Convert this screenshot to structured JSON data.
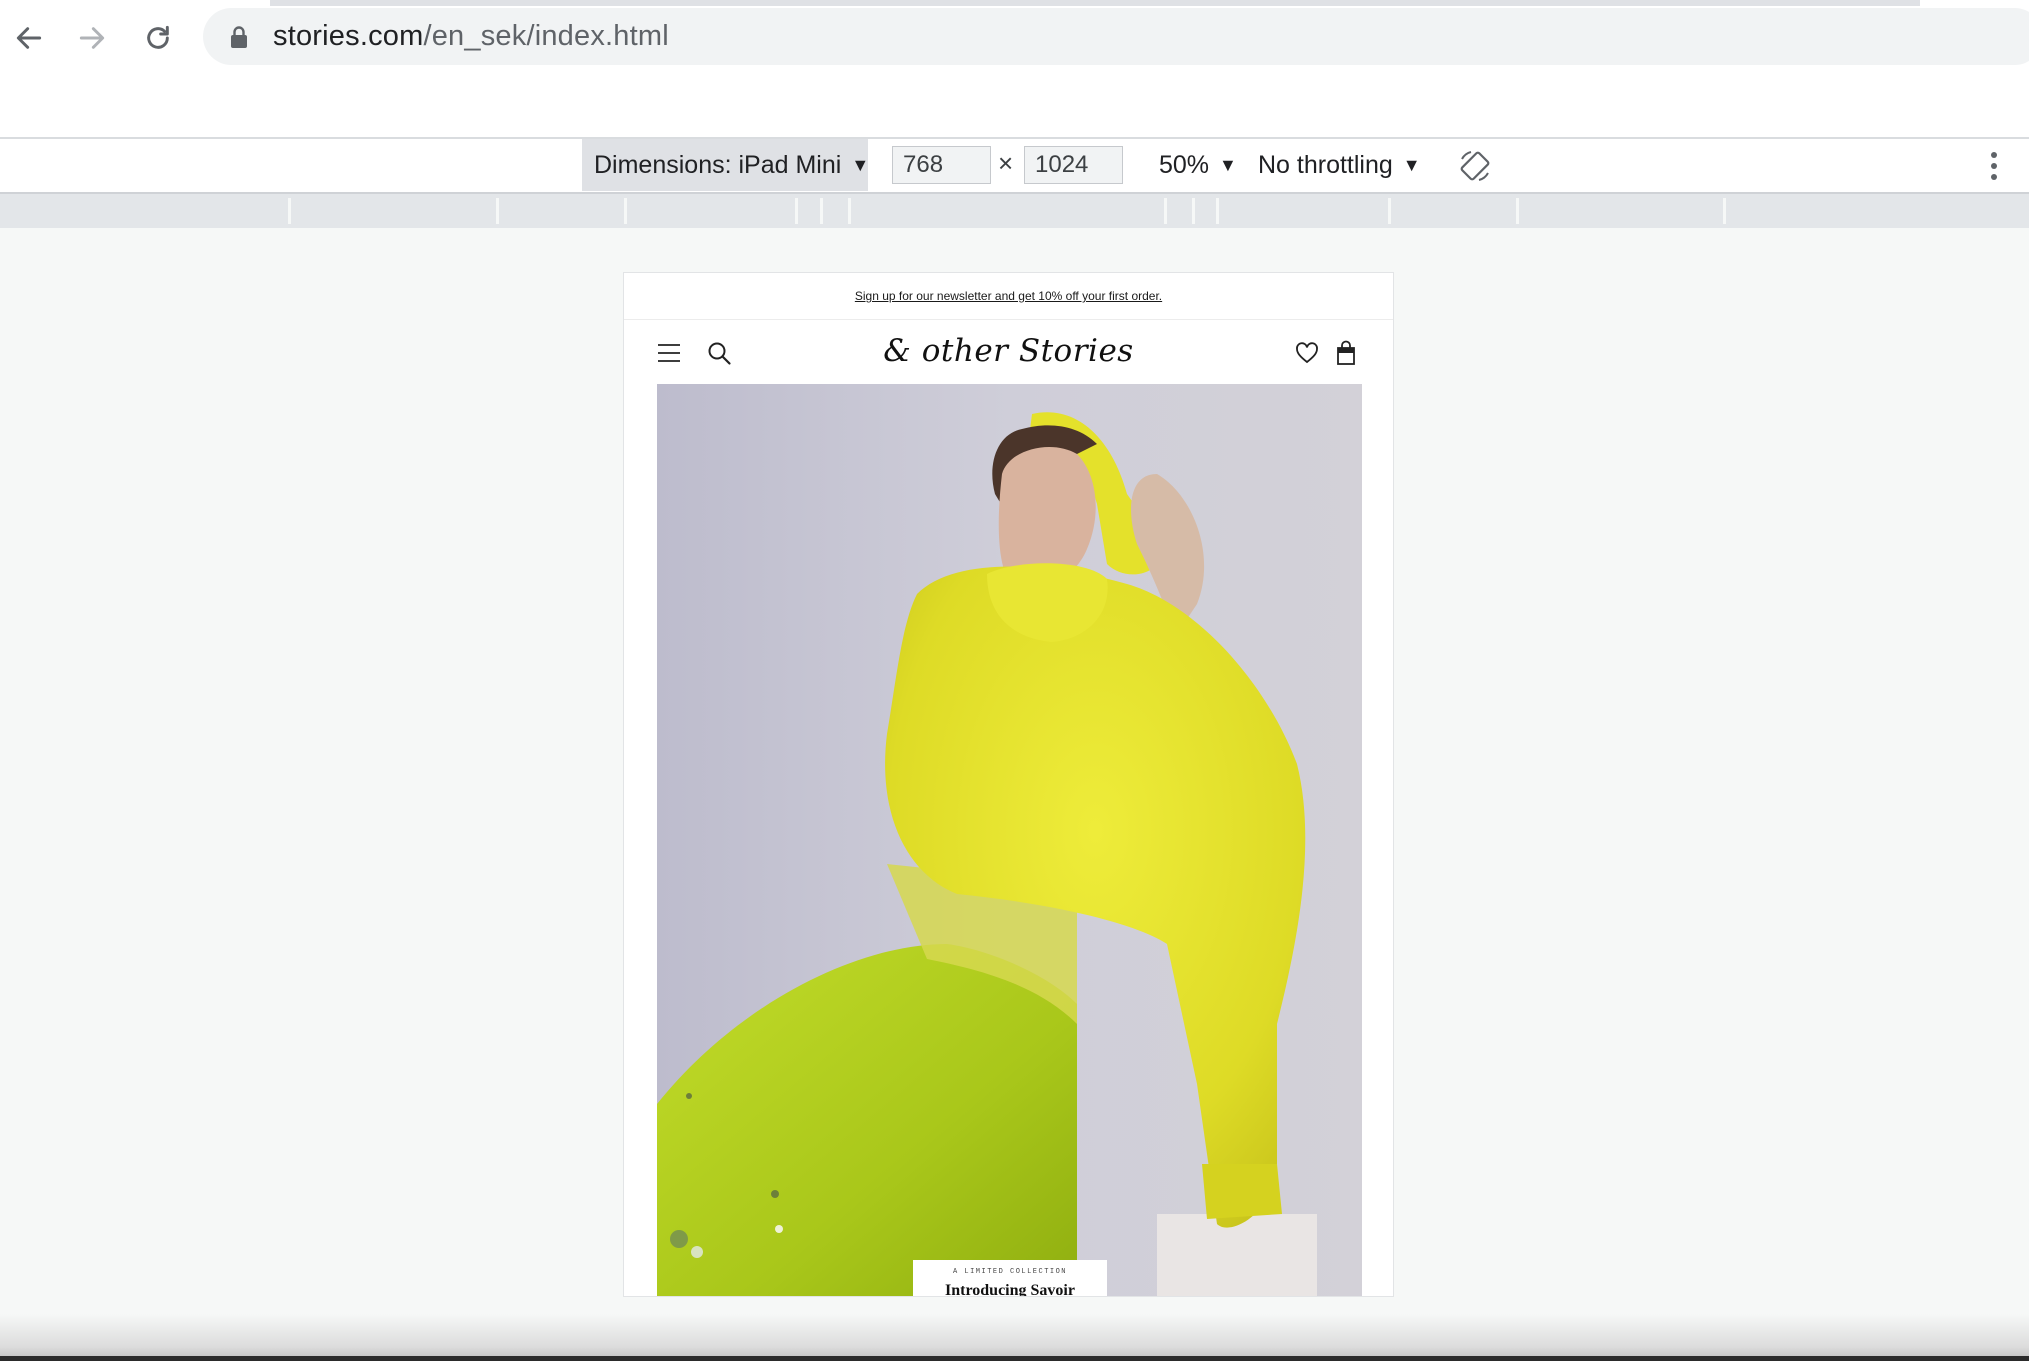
{
  "browser": {
    "url_domain": "stories.com",
    "url_path": "/en_sek/index.html"
  },
  "devtools": {
    "device_label": "Dimensions: iPad Mini",
    "width_value": "768",
    "height_value": "1024",
    "times_symbol": "×",
    "zoom_label": "50%",
    "throttle_label": "No throttling",
    "caret": "▼"
  },
  "site": {
    "promo_text": "Sign up for our newsletter and get 10% off your first order.",
    "logo_text": "& other Stories",
    "hero": {
      "eyebrow": "A LIMITED COLLECTION",
      "title": "Introducing Savoir"
    }
  },
  "icons": {
    "back": "arrow-left-icon",
    "forward": "arrow-right-icon",
    "reload": "reload-icon",
    "lock": "lock-icon",
    "rotate": "rotate-icon",
    "more": "kebab-icon",
    "menu": "hamburger-icon",
    "search": "search-icon",
    "wishlist": "heart-icon",
    "bag": "shopping-bag-icon"
  },
  "colors": {
    "sweater": "#e3e229",
    "skirt": "#b4d31c",
    "backdrop": "#c8c7d6"
  }
}
